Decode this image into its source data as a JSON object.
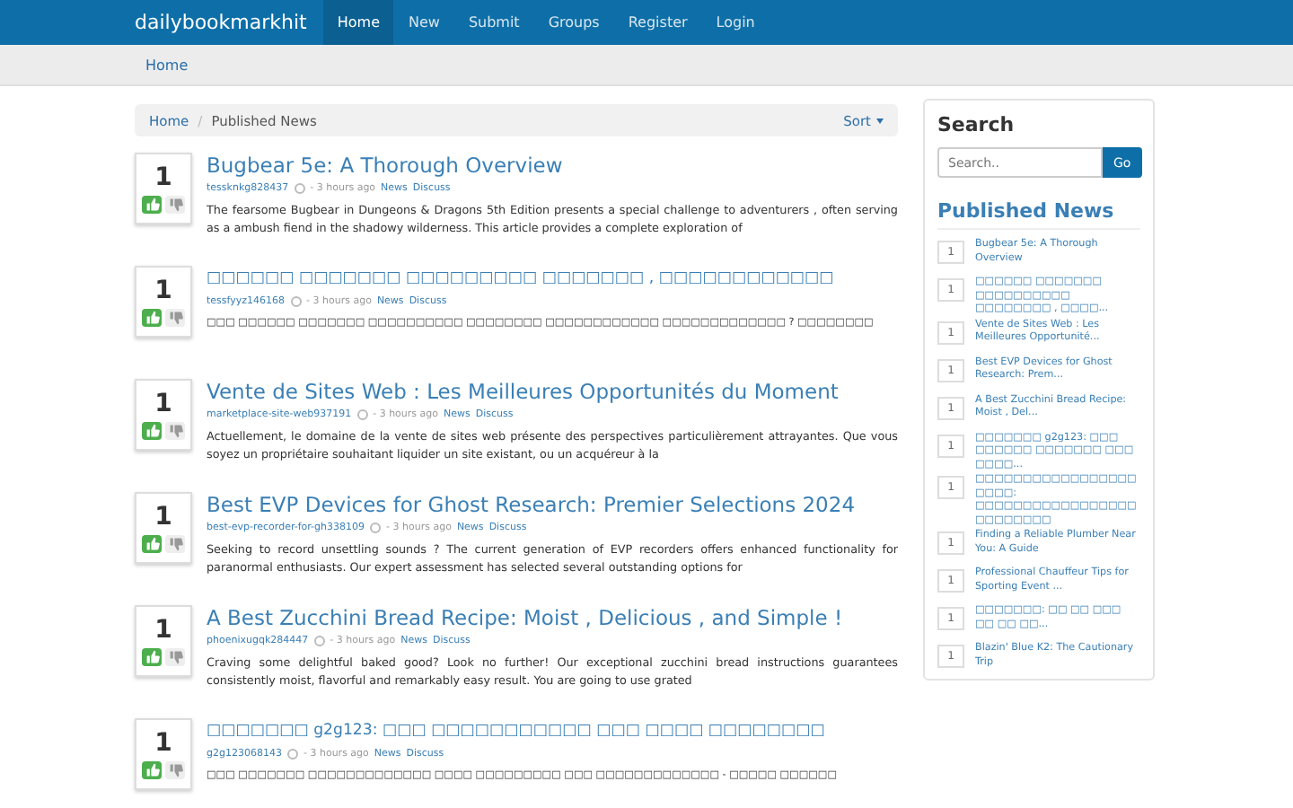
{
  "navbar": {
    "brand": "dailybookmarkhit",
    "items": [
      {
        "label": "Home",
        "selected": true
      },
      {
        "label": "New",
        "selected": false
      },
      {
        "label": "Submit",
        "selected": false
      },
      {
        "label": "Groups",
        "selected": false
      },
      {
        "label": "Register",
        "selected": false
      },
      {
        "label": "Login",
        "selected": false
      }
    ]
  },
  "subbar": {
    "link": "Home"
  },
  "breadcrumb": {
    "items": [
      "Home",
      "Published News"
    ],
    "separator": "/",
    "sort": "Sort"
  },
  "posts": [
    {
      "votes": "1",
      "title": "Bugbear 5e: A Thorough Overview",
      "author": "tessknkg828437",
      "time": "- 3 hours ago",
      "category": "News",
      "discuss": "Discuss",
      "excerpt": "The fearsome Bugbear in Dungeons & Dragons 5th Edition presents a special challenge to adventurers , often serving as a ambush fiend in the shadowy wilderness. This article provides a complete exploration of"
    },
    {
      "votes": "1",
      "title": "□□□□□□ □□□□□□□ □□□□□□□□□ □□□□□□□ , □□□□□□□□□□□□",
      "author": "tessfyyz146168",
      "time": "- 3 hours ago",
      "category": "News",
      "discuss": "Discuss",
      "excerpt": "□□□ □□□□□□ □□□□□□□ □□□□□□□□□□ □□□□□□□□ □□□□□□□□□□□□ □□□□□□□□□□□□□ ? □□□□□□□□"
    },
    {
      "votes": "1",
      "title": "Vente de Sites Web : Les Meilleures Opportunités du Moment",
      "author": "marketplace-site-web937191",
      "time": "- 3 hours ago",
      "category": "News",
      "discuss": "Discuss",
      "excerpt": "Actuellement, le domaine de la vente de sites web présente des perspectives particulièrement attrayantes. Que vous soyez un propriétaire souhaitant liquider un site existant, ou un acquéreur à la"
    },
    {
      "votes": "1",
      "title": "Best EVP Devices for Ghost Research: Premier Selections 2024",
      "author": "best-evp-recorder-for-gh338109",
      "time": "- 3 hours ago",
      "category": "News",
      "discuss": "Discuss",
      "excerpt": "Seeking to record unsettling sounds ? The current generation of EVP recorders offers enhanced functionality for paranormal enthusiasts. Our expert assessment has selected several outstanding options for"
    },
    {
      "votes": "1",
      "title": "A Best Zucchini Bread Recipe: Moist , Delicious , and Simple !",
      "author": "phoenixugqk284447",
      "time": "- 3 hours ago",
      "category": "News",
      "discuss": "Discuss",
      "excerpt": "Craving some delightful baked good? Look no further! Our exceptional zucchini bread instructions guarantees consistently moist, flavorful and remarkably easy result. You are going to use grated"
    },
    {
      "votes": "1",
      "title": "□□□□□□□ g2g123: □□□ □□□□□□□□□□□ □□□ □□□□ □□□□□□□□",
      "author": "g2g123068143",
      "time": "- 3 hours ago",
      "category": "News",
      "discuss": "Discuss",
      "excerpt": "□□□ □□□□□□□ □□□□□□□□□□□□□ □□□□ □□□□□□□□□ □□□ □□□□□□□□□□□□□ - □□□□□ □□□□□□"
    }
  ],
  "sidebar": {
    "search_title": "Search",
    "search": {
      "placeholder": "Search.."
    },
    "go": "Go",
    "news_title": "Published News",
    "news": [
      {
        "votes": "1",
        "title": "Bugbear 5e: A Thorough Overview"
      },
      {
        "votes": "1",
        "title": "□□□□□□ □□□□□□□ □□□□□□□□□□ □□□□□□□□ , □□□□..."
      },
      {
        "votes": "1",
        "title": "Vente de Sites Web : Les Meilleures Opportunité..."
      },
      {
        "votes": "1",
        "title": "Best EVP Devices for Ghost Research: Prem..."
      },
      {
        "votes": "1",
        "title": "A Best Zucchini Bread Recipe: Moist , Del..."
      },
      {
        "votes": "1",
        "title": "□□□□□□□ g2g123: □□□ □□□□□□ □□□□□□□ □□□ □□□□..."
      },
      {
        "votes": "1",
        "title": "□□□□□□□□□□□□□□□□□□□□□: □□□□□□□□□□□□□□□□□□□□□□□□□"
      },
      {
        "votes": "1",
        "title": "Finding a Reliable Plumber Near You: A Guide"
      },
      {
        "votes": "1",
        "title": "Professional Chauffeur Tips for Sporting Event ..."
      },
      {
        "votes": "1",
        "title": "□□□□□□□: □□ □□ □□□ □□ □□ □□..."
      },
      {
        "votes": "1",
        "title": "Blazin' Blue K2: The Cautionary Trip"
      }
    ]
  }
}
